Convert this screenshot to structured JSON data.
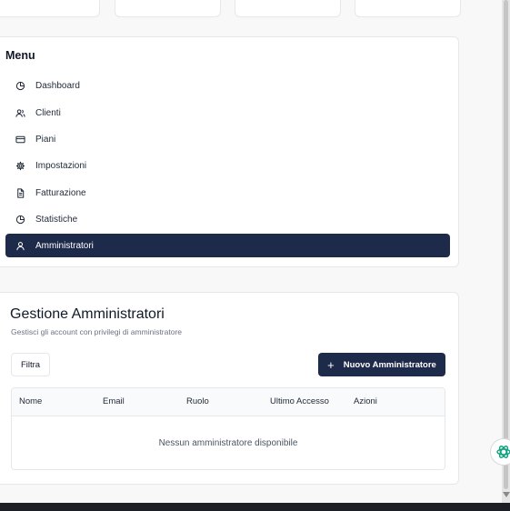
{
  "menu": {
    "title": "Menu",
    "items": [
      {
        "label": "Dashboard",
        "icon": "pie-chart-icon"
      },
      {
        "label": "Clienti",
        "icon": "users-icon"
      },
      {
        "label": "Piani",
        "icon": "credit-card-icon"
      },
      {
        "label": "Impostazioni",
        "icon": "gear-icon"
      },
      {
        "label": "Fatturazione",
        "icon": "document-icon"
      },
      {
        "label": "Statistiche",
        "icon": "pie-chart-icon"
      },
      {
        "label": "Amministratori",
        "icon": "user-icon",
        "active": true
      }
    ]
  },
  "admin": {
    "title": "Gestione Amministratori",
    "subtitle": "Gestisci gli account con privilegi di amministratore",
    "filter_label": "Filtra",
    "new_label": "Nuovo Amministratore",
    "columns": [
      "Nome",
      "Email",
      "Ruolo",
      "Ultimo Accesso",
      "Azioni"
    ],
    "empty_text": "Nessun amministratore disponibile"
  },
  "colors": {
    "accent": "#1e2a4a",
    "border": "#e5e7eb",
    "background": "#f8f8f9"
  }
}
